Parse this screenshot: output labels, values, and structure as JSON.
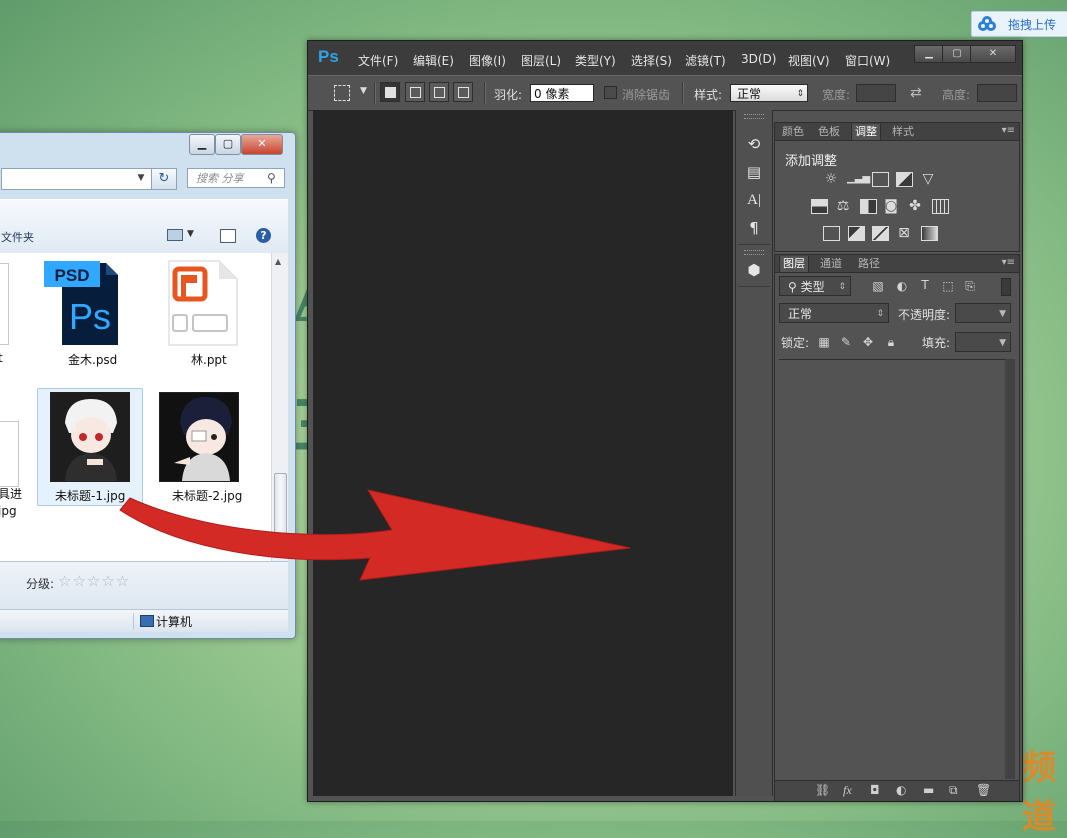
{
  "upload": {
    "label": "拖拽上传"
  },
  "background": {
    "glyph_top": "A",
    "glyph_mid": "三",
    "corner_text": "频道"
  },
  "explorer": {
    "search_placeholder": "搜索 分享",
    "refresh_symbol": "↻",
    "folder_label": "文件夹",
    "help": "?",
    "files": [
      {
        "name": "t",
        "kind": "partial-doc"
      },
      {
        "name": "金木.psd",
        "kind": "psd",
        "icon_text_top": "PSD",
        "icon_text_main": "Ps"
      },
      {
        "name": "林.ppt",
        "kind": "ppt"
      },
      {
        "name": "具进",
        "name2": "jpg",
        "kind": "partial-doc"
      },
      {
        "name": "未标题-1.jpg",
        "kind": "photo",
        "selected": true
      },
      {
        "name": "未标题-2.jpg",
        "kind": "photo"
      }
    ],
    "rating_label": "分级:",
    "rating_stars": "☆☆☆☆☆",
    "status_location": "计算机"
  },
  "photoshop": {
    "logo": "Ps",
    "menu": [
      "文件(F)",
      "编辑(E)",
      "图像(I)",
      "图层(L)",
      "类型(Y)",
      "选择(S)",
      "滤镜(T)",
      "3D(D)",
      "视图(V)",
      "窗口(W)"
    ],
    "options": {
      "feather_label": "羽化:",
      "feather_value": "0 像素",
      "antialias_label": "消除锯齿",
      "style_label": "样式:",
      "style_value": "正常",
      "width_label": "宽度:",
      "height_label": "高度:"
    },
    "adjust_panel": {
      "tabs": [
        "颜色",
        "色板",
        "调整",
        "样式"
      ],
      "active_tab": "调整",
      "title": "添加调整"
    },
    "layers_panel": {
      "tabs": [
        "图层",
        "通道",
        "路径"
      ],
      "active_tab": "图层",
      "filter_label": "类型",
      "blend_mode": "正常",
      "opacity_label": "不透明度:",
      "lock_label": "锁定:",
      "fill_label": "填充:"
    }
  },
  "colors": {
    "ps_blue": "#2fa3e8",
    "arrow_red": "#d42a25",
    "psd_blue": "#31a8ff",
    "ppt_orange": "#e8561f"
  }
}
